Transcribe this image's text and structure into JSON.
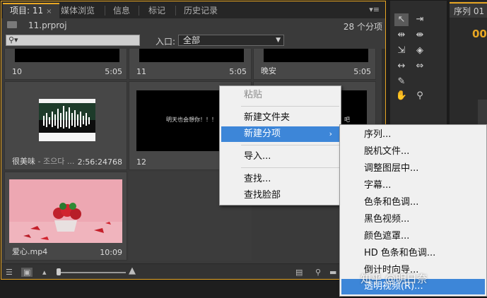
{
  "tabs": [
    {
      "label": "项目: 11",
      "active": true
    },
    {
      "label": "媒体浏览",
      "active": false
    },
    {
      "label": "信息",
      "active": false
    },
    {
      "label": "标记",
      "active": false
    },
    {
      "label": "历史记录",
      "active": false
    }
  ],
  "tab_close": "×",
  "panel_menu": "▾≡",
  "project_file": "11.prproj",
  "item_count": "28 个分项",
  "search_icon": "⚲▾",
  "entry_label": "入口:",
  "entry_value": "全部",
  "cells": [
    {
      "name": "10",
      "duration": "5:05"
    },
    {
      "name": "11",
      "duration": "5:05"
    },
    {
      "name": "晚安",
      "duration": "5:05"
    },
    {
      "name": "很美味",
      "name_sub": "- 조으다 ...",
      "duration": "2:56:24768"
    },
    {
      "name": "12",
      "duration": ""
    },
    {
      "name": "爱心.mp4",
      "duration": "10:09"
    }
  ],
  "black_frame_text": "明天也会想你！！！",
  "black_frame_text2": "吧",
  "seq_tab": "序列 01",
  "timecode": "00:",
  "context_menu": {
    "items": [
      "粘贴",
      "新建文件夹",
      "新建分项",
      "导入...",
      "查找...",
      "查找脸部"
    ],
    "submenu_arrow": "›"
  },
  "submenu": {
    "items": [
      "序列...",
      "脱机文件...",
      "调整图层中...",
      "字幕...",
      "色条和色调...",
      "黑色视频...",
      "颜色遮罩...",
      "HD 色条和色调...",
      "倒计时向导...",
      "透明视频(R)..."
    ]
  },
  "watermark": "知乎 @明日奈",
  "colors": {
    "accent": "#e8a623",
    "menu_highlight": "#3d86d8"
  }
}
